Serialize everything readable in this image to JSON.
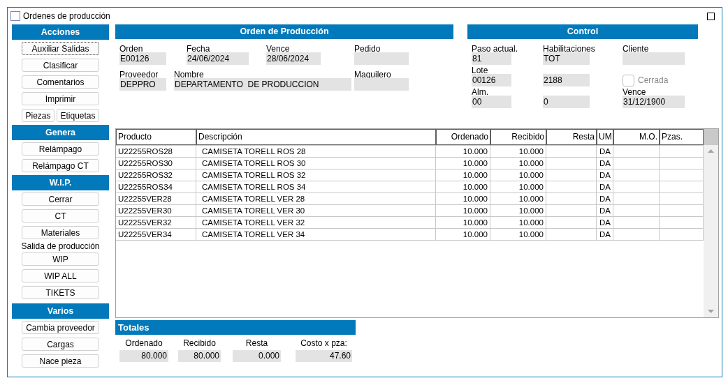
{
  "window": {
    "title": "Ordenes de producción"
  },
  "sidebar": {
    "sections": [
      {
        "title": "Acciones",
        "items": [
          {
            "kind": "button",
            "label": "Auxiliar Salidas",
            "focused": true
          },
          {
            "kind": "button",
            "label": "Clasificar",
            "focused": false
          },
          {
            "kind": "button",
            "label": "Comentarios",
            "focused": false
          },
          {
            "kind": "button",
            "label": "Imprimir",
            "focused": false
          },
          {
            "kind": "button_row",
            "buttons": [
              {
                "label": "Piezas",
                "focused": false
              },
              {
                "label": "Etiquetas",
                "focused": false
              }
            ]
          }
        ]
      },
      {
        "title": "Genera",
        "items": [
          {
            "kind": "button",
            "label": "Relámpago",
            "focused": false
          },
          {
            "kind": "button",
            "label": "Relámpago CT",
            "focused": false
          }
        ]
      },
      {
        "title": "W.I.P.",
        "items": [
          {
            "kind": "button",
            "label": "Cerrar",
            "focused": false
          },
          {
            "kind": "button",
            "label": "CT",
            "focused": false
          },
          {
            "kind": "button",
            "label": "Materiales",
            "focused": false
          },
          {
            "kind": "label",
            "text": "Salida de producción"
          },
          {
            "kind": "button",
            "label": "WIP",
            "focused": false
          },
          {
            "kind": "button",
            "label": "WIP ALL",
            "focused": false
          },
          {
            "kind": "button",
            "label": "TIKETS",
            "focused": false
          }
        ]
      },
      {
        "title": "Varios",
        "items": [
          {
            "kind": "button",
            "label": "Cambia proveedor",
            "focused": false
          },
          {
            "kind": "button",
            "label": "Cargas",
            "focused": false
          },
          {
            "kind": "button",
            "label": "Nace pieza",
            "focused": false
          }
        ]
      }
    ]
  },
  "order": {
    "title": "Orden de Producción",
    "rows": [
      {
        "fields": [
          {
            "kind": "field",
            "label": "Orden",
            "value": "E00126"
          },
          {
            "kind": "field",
            "label": "Fecha",
            "value": "24/06/2024"
          },
          {
            "kind": "field",
            "label": "Vence",
            "value": "28/06/2024"
          },
          {
            "kind": "field",
            "label": "Pedido"
          }
        ]
      },
      {
        "fields": [
          {
            "kind": "field",
            "label": "Proveedor",
            "value": "DEPPRO"
          },
          {
            "kind": "field",
            "label": "Nombre",
            "value": "DEPARTAMENTO  DE PRODUCCION"
          },
          {
            "kind": "field",
            "label": "Maquilero"
          }
        ]
      }
    ]
  },
  "control": {
    "title": "Control",
    "rows": [
      {
        "fields": [
          {
            "kind": "field",
            "label": "Paso actual.",
            "value": "81"
          },
          {
            "kind": "field",
            "label": "Habilitaciones",
            "value": "TOT"
          },
          {
            "kind": "field",
            "label": "Cliente"
          }
        ]
      },
      {
        "fields": [
          {
            "kind": "field",
            "label": "Lote",
            "value": "00126"
          },
          {
            "kind": "field",
            "value": "2188"
          },
          {
            "kind": "checkbox",
            "label": "Cerrada",
            "checked": false,
            "disabled": true
          }
        ]
      },
      {
        "fields": [
          {
            "kind": "field",
            "label": "Alm.",
            "value": "00"
          },
          {
            "kind": "field",
            "value": "0"
          },
          {
            "kind": "field",
            "label": "Vence",
            "value": "31/12/1900"
          }
        ]
      }
    ]
  },
  "table": {
    "columns": [
      "Producto",
      "Descripción",
      "Ordenado",
      "Recibido",
      "Resta",
      "UM",
      "M.O.",
      "Pzas."
    ],
    "rows": [
      [
        "U22255ROS28",
        "CAMISETA TORELL ROS 28",
        "10.000",
        "10.000",
        "",
        "DA",
        "",
        ""
      ],
      [
        "U22255ROS30",
        "CAMISETA TORELL ROS 30",
        "10.000",
        "10.000",
        "",
        "DA",
        "",
        ""
      ],
      [
        "U22255ROS32",
        "CAMISETA TORELL ROS 32",
        "10.000",
        "10.000",
        "",
        "DA",
        "",
        ""
      ],
      [
        "U22255ROS34",
        "CAMISETA TORELL ROS 34",
        "10.000",
        "10.000",
        "",
        "DA",
        "",
        ""
      ],
      [
        "U22255VER28",
        "CAMISETA TORELL VER 28",
        "10.000",
        "10.000",
        "",
        "DA",
        "",
        ""
      ],
      [
        "U22255VER30",
        "CAMISETA TORELL VER 30",
        "10.000",
        "10.000",
        "",
        "DA",
        "",
        ""
      ],
      [
        "U22255VER32",
        "CAMISETA TORELL VER 32",
        "10.000",
        "10.000",
        "",
        "DA",
        "",
        ""
      ],
      [
        "U22255VER34",
        "CAMISETA TORELL VER 34",
        "10.000",
        "10.000",
        "",
        "DA",
        "",
        ""
      ]
    ]
  },
  "totals": {
    "title": "Totales",
    "fields": [
      {
        "label": "Ordenado",
        "value": "80.000"
      },
      {
        "label": "Recibido",
        "value": "80.000"
      },
      {
        "label": "Resta",
        "value": "0.000"
      },
      {
        "label": "Costo x pza:",
        "value": "47.60"
      }
    ]
  }
}
